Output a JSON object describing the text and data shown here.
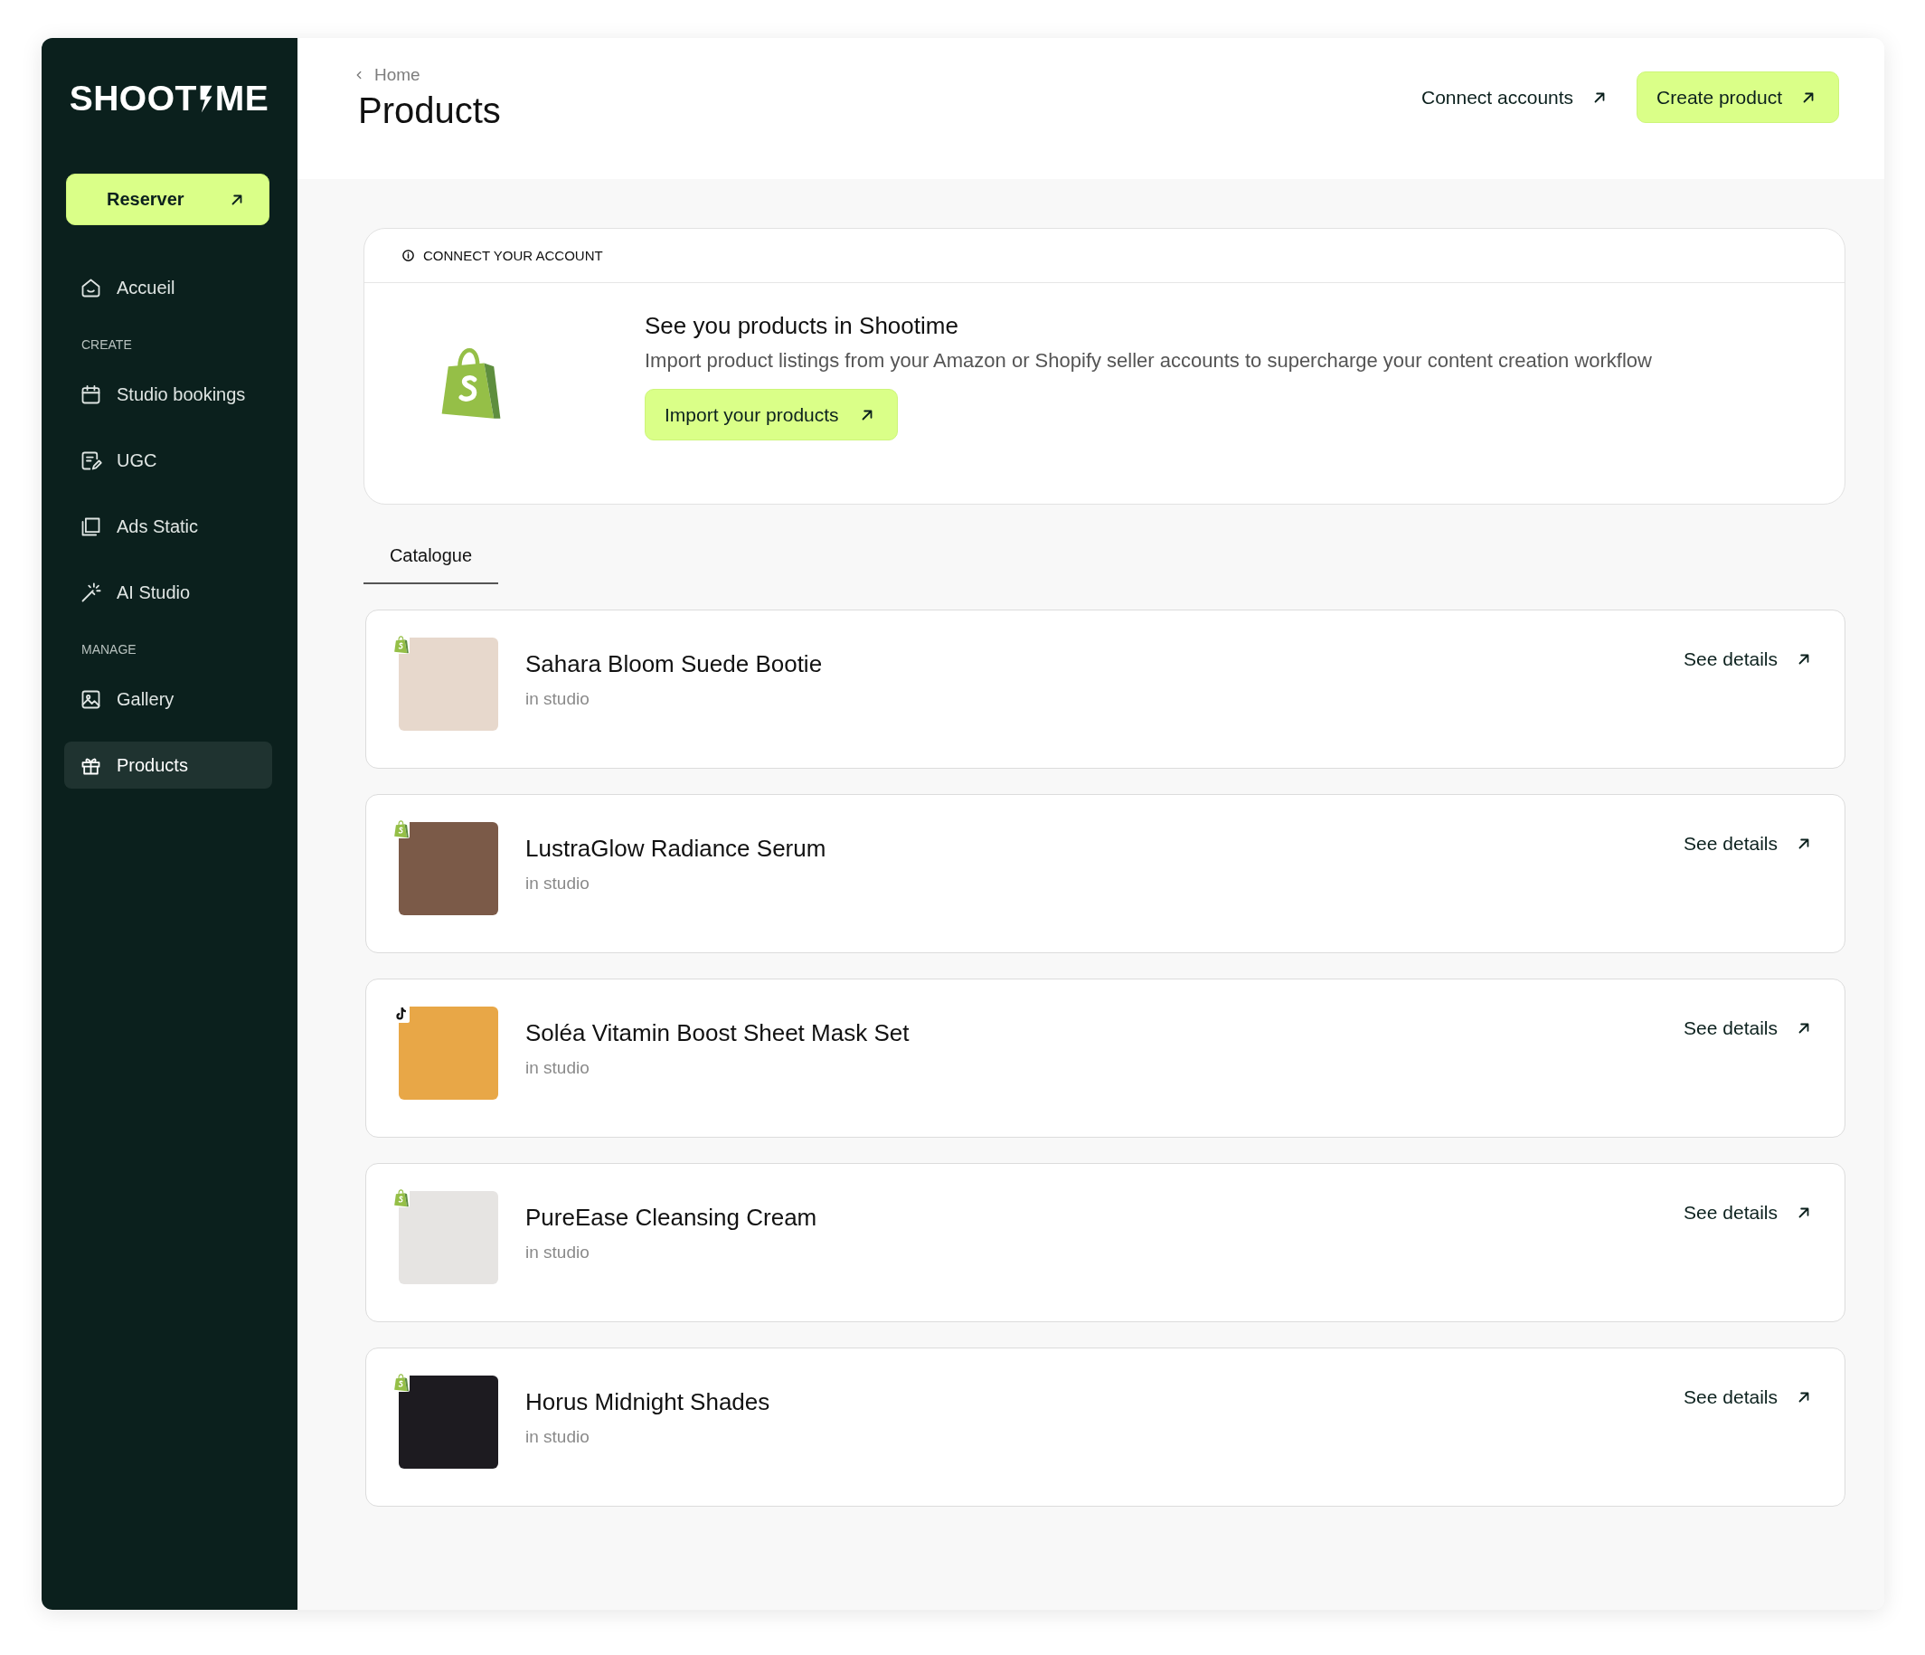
{
  "sidebar": {
    "logo": {
      "left": "SHOOT",
      "right": "ME"
    },
    "cta": "Reserver",
    "sections": [
      {
        "items": [
          {
            "label": "Accueil",
            "selected": false
          }
        ]
      },
      {
        "heading": "CREATE",
        "items": [
          {
            "label": "Studio bookings",
            "selected": false
          },
          {
            "label": "UGC",
            "selected": false
          },
          {
            "label": "Ads Static",
            "selected": false
          },
          {
            "label": "AI Studio",
            "selected": false
          }
        ]
      },
      {
        "heading": "MANAGE",
        "items": [
          {
            "label": "Gallery",
            "selected": false
          },
          {
            "label": "Products",
            "selected": true
          }
        ]
      }
    ]
  },
  "header": {
    "breadcrumb": "Home",
    "title": "Products",
    "actions": [
      {
        "label": "Connect accounts",
        "kind": "link"
      },
      {
        "label": "Create product",
        "kind": "primary"
      }
    ]
  },
  "connect_card": {
    "heading": "CONNECT YOUR ACCOUNT",
    "title": "See you products in Shootime",
    "text": "Import product listings from your Amazon or Shopify seller accounts to supercharge your content creation workflow",
    "button": "Import your products"
  },
  "tabs": [
    {
      "label": "Catalogue",
      "selected": true
    }
  ],
  "products": [
    {
      "name": "Sahara Bloom Suede Bootie",
      "status": "in studio",
      "kind": "shopify",
      "action": "See details"
    },
    {
      "name": "LustraGlow Radiance Serum",
      "status": "in studio",
      "kind": "shopify",
      "action": "See details"
    },
    {
      "name": "Soléa Vitamin Boost Sheet Mask Set",
      "status": "in studio",
      "kind": "tiktok",
      "action": "See details"
    },
    {
      "name": "PureEase Cleansing Cream",
      "status": "in studio",
      "kind": "shopify",
      "action": "See details"
    },
    {
      "name": "Horus Midnight Shades",
      "status": "in studio",
      "kind": "shopify",
      "action": "See details"
    }
  ]
}
